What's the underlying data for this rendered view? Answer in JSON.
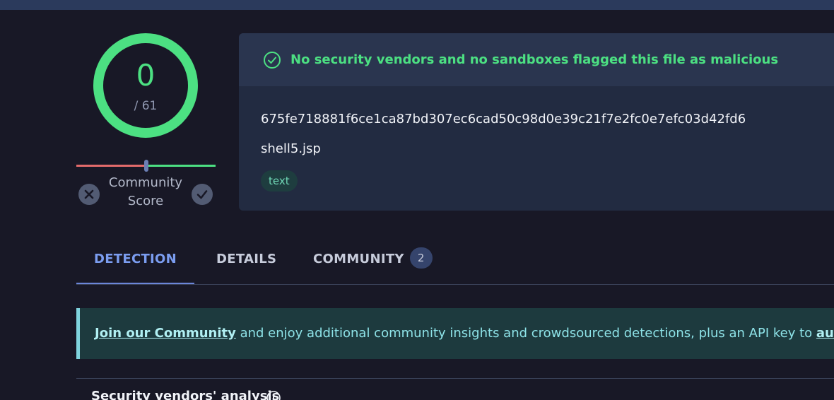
{
  "score": {
    "detected": "0",
    "total": "/ 61",
    "ring_color": "#4ce082"
  },
  "community_score": {
    "label": "Community Score",
    "down_icon": "x-circle-icon",
    "up_icon": "check-circle-icon",
    "value": 0.5
  },
  "summary": {
    "status_icon": "check-circle-icon",
    "status": "No security vendors and no sandboxes flagged this file as malicious",
    "hash": "675fe718881f6ce1ca87bd307ec6cad50c98d0e39c21f7e2fc0e7efc03d42fd6",
    "filename": "shell5.jsp",
    "tag": "text"
  },
  "tabs": [
    {
      "label": "DETECTION",
      "active": true
    },
    {
      "label": "DETAILS",
      "active": false
    },
    {
      "label": "COMMUNITY",
      "active": false,
      "count": "2"
    }
  ],
  "banner": {
    "link_join": "Join our Community",
    "text": " and enjoy additional community insights and crowdsourced detections, plus an API key to ",
    "link_automate": "automa"
  },
  "section": {
    "heading": "Security vendors' analysis",
    "info_icon": "info-icon"
  },
  "colors": {
    "background": "#181826",
    "card": "#222b41",
    "success": "#4ce082",
    "accent": "#7b9df0"
  }
}
